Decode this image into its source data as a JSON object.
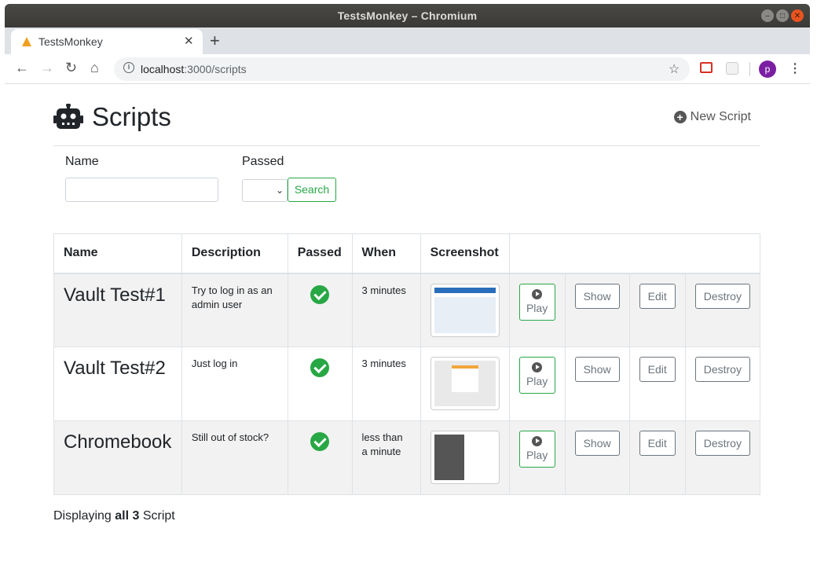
{
  "window": {
    "title": "TestsMonkey – Chromium"
  },
  "browser": {
    "tab_title": "TestsMonkey",
    "url_host": "localhost",
    "url_path": ":3000/scripts",
    "profile_initial": "p"
  },
  "page": {
    "heading": "Scripts",
    "new_script_label": "New Script",
    "filters": {
      "name_label": "Name",
      "name_value": "",
      "passed_label": "Passed",
      "passed_value": "",
      "search_label": "Search"
    },
    "table": {
      "columns": [
        "Name",
        "Description",
        "Passed",
        "When",
        "Screenshot",
        ""
      ],
      "rows": [
        {
          "name": "Vault Test#1",
          "description": "Try to log in as an admin user",
          "passed": true,
          "when": "3 minutes",
          "play": "Play",
          "show": "Show",
          "edit": "Edit",
          "destroy": "Destroy"
        },
        {
          "name": "Vault Test#2",
          "description": "Just log in",
          "passed": true,
          "when": "3 minutes",
          "play": "Play",
          "show": "Show",
          "edit": "Edit",
          "destroy": "Destroy"
        },
        {
          "name": "Chromebook",
          "description": "Still out of stock?",
          "passed": true,
          "when": "less than a minute",
          "play": "Play",
          "show": "Show",
          "edit": "Edit",
          "destroy": "Destroy"
        }
      ]
    },
    "footer": {
      "prefix": "Displaying ",
      "count": "all 3",
      "suffix": " Script"
    }
  },
  "colors": {
    "accent_green": "#28a745",
    "profile_purple": "#7b1fa2"
  }
}
